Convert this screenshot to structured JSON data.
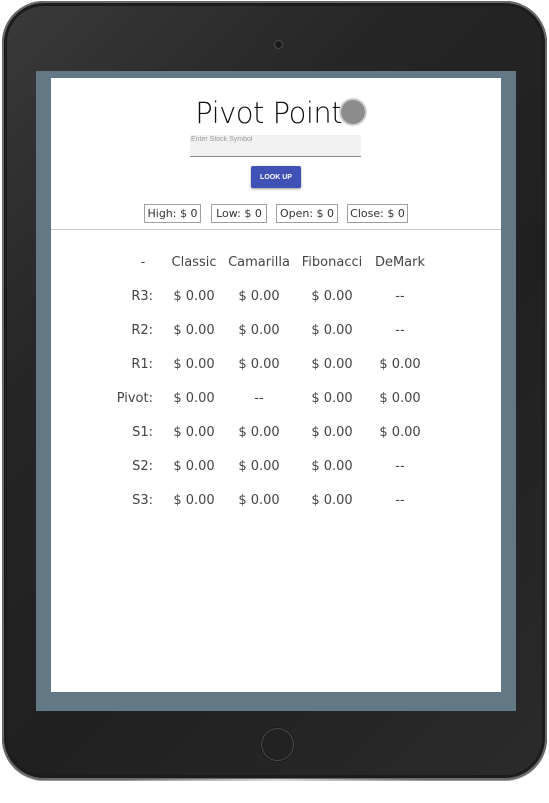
{
  "app": {
    "title": "Pivot Points",
    "search": {
      "placeholder": "Enter Stock Symbol",
      "value": ""
    },
    "lookup_label": "LOOK UP"
  },
  "prices": {
    "high": "High: $ 0",
    "low": "Low: $ 0",
    "open": "Open: $ 0",
    "close": "Close: $ 0"
  },
  "table": {
    "headers": [
      "-",
      "Classic",
      "Camarilla",
      "Fibonacci",
      "DeMark"
    ],
    "rows": [
      {
        "label": "R3:",
        "values": [
          "$ 0.00",
          "$ 0.00",
          "$ 0.00",
          "--"
        ]
      },
      {
        "label": "R2:",
        "values": [
          "$ 0.00",
          "$ 0.00",
          "$ 0.00",
          "--"
        ]
      },
      {
        "label": "R1:",
        "values": [
          "$ 0.00",
          "$ 0.00",
          "$ 0.00",
          "$ 0.00"
        ]
      },
      {
        "label": "Pivot:",
        "values": [
          "$ 0.00",
          "--",
          "$ 0.00",
          "$ 0.00"
        ]
      },
      {
        "label": "S1:",
        "values": [
          "$ 0.00",
          "$ 0.00",
          "$ 0.00",
          "$ 0.00"
        ]
      },
      {
        "label": "S2:",
        "values": [
          "$ 0.00",
          "$ 0.00",
          "$ 0.00",
          "--"
        ]
      },
      {
        "label": "S3:",
        "values": [
          "$ 0.00",
          "$ 0.00",
          "$ 0.00",
          "--"
        ]
      }
    ]
  },
  "icons": {
    "spinner": "loading-spinner-icon",
    "camera": "front-camera-icon",
    "home": "home-button-icon"
  },
  "colors": {
    "accent": "#3f51b5",
    "frame": "#627884",
    "device": "#262626"
  }
}
